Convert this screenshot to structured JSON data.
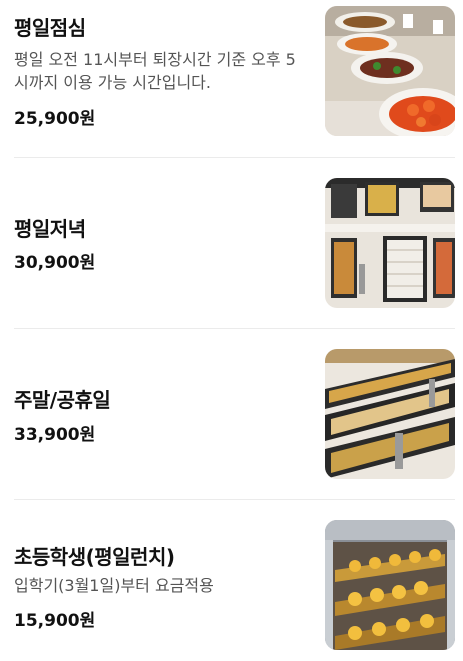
{
  "menu": {
    "items": [
      {
        "title": "평일점심",
        "description": "평일 오전 11시부터 퇴장시간 기준 오후 5시까지 이용 가능 시간입니다.",
        "price": "25,900원",
        "image": "buffet-salad-dishes-photo"
      },
      {
        "title": "평일저녁",
        "description": "",
        "price": "30,900원",
        "image": "buffet-sushi-trays-photo"
      },
      {
        "title": "주말/공휴일",
        "description": "",
        "price": "33,900원",
        "image": "buffet-sushi-counter-photo"
      },
      {
        "title": "초등학생(평일런치)",
        "description": "입학기(3월1일)부터 요금적용",
        "price": "15,900원",
        "image": "buffet-tart-display-photo"
      }
    ]
  }
}
